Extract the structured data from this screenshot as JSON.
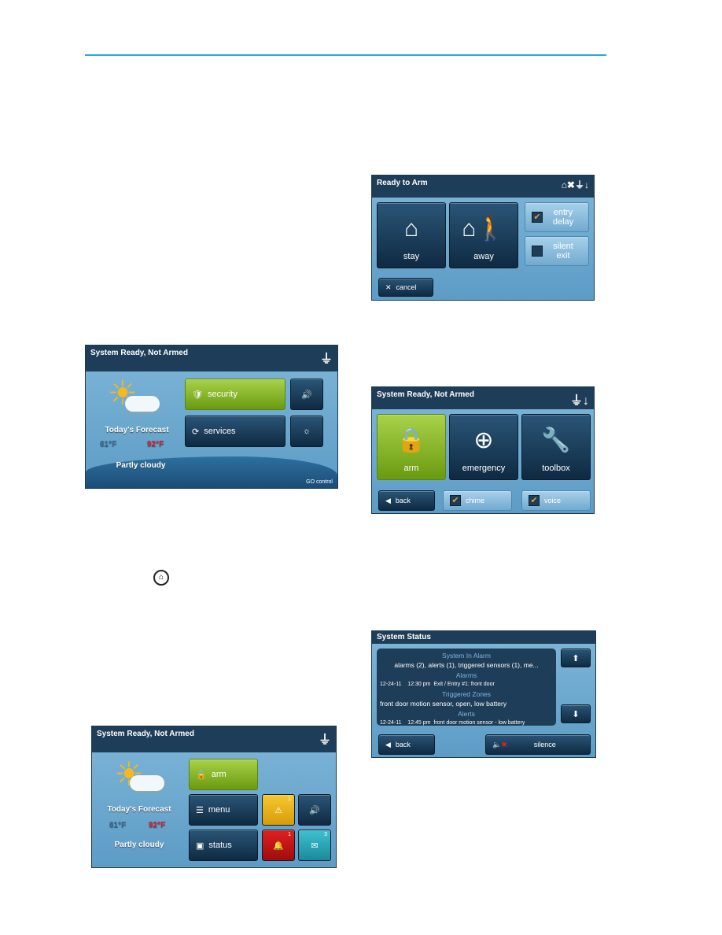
{
  "home_screen": {
    "title": "System Ready, Not Armed",
    "power_icon": "plug-icon",
    "forecast_label": "Today's Forecast",
    "low": "61°F",
    "high": "92°F",
    "condition": "Partly cloudy",
    "security": "security",
    "services": "services",
    "logo": "GO control"
  },
  "arm_screen": {
    "title": "Ready to Arm",
    "stay": "stay",
    "away": "away",
    "entry_delay": "entry delay",
    "entry_delay_checked": true,
    "silent_exit": "silent exit",
    "silent_exit_checked": false,
    "cancel": "cancel"
  },
  "security_screen": {
    "title": "System Ready, Not Armed",
    "arm": "arm",
    "emergency": "emergency",
    "toolbox": "toolbox",
    "back": "back",
    "chime": "chime",
    "chime_checked": true,
    "voice": "voice",
    "voice_checked": true
  },
  "home_icon": "home-circle-icon",
  "home_screen_2": {
    "title": "System Ready, Not Armed",
    "forecast_label": "Today's Forecast",
    "low": "61°F",
    "high": "92°F",
    "condition": "Partly cloudy",
    "arm": "arm",
    "menu": "menu",
    "status": "status",
    "alert_count": "1",
    "alarm_count": "1",
    "message_count": "3"
  },
  "status_screen": {
    "title": "System Status",
    "heading": "System In Alarm",
    "summary": "alarms (2), alerts (1), triggered sensors (1), me...",
    "alarms_heading": "Alarms",
    "alarm_entry": {
      "date": "12-24-11",
      "time": "12:30 pm",
      "text": "Exit / Entry #1: front door"
    },
    "zones_heading": "Triggered Zones",
    "zone_entry": "front door motion sensor, open, low battery",
    "alerts_heading": "Alerts",
    "alert_entry": {
      "date": "12-24-11",
      "time": "12:45 pm",
      "text": "front door motion sensor - low battery"
    },
    "back": "back",
    "silence": "silence"
  },
  "colors": {
    "accent_rule": "#29a8d8",
    "title_bar": "#1e3d58",
    "green_button": "#8bbb2a"
  }
}
